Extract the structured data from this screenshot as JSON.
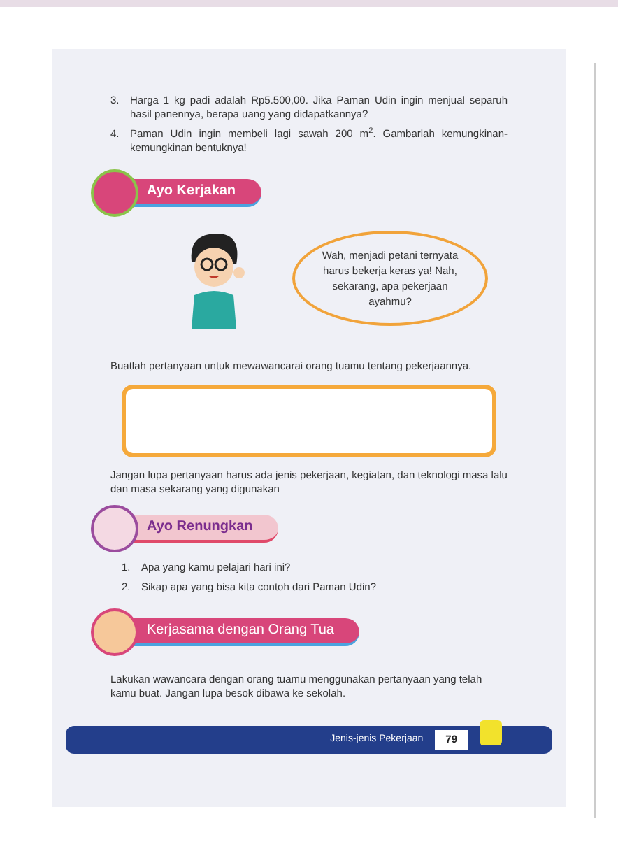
{
  "page": {
    "questions": [
      {
        "number": "3.",
        "text": "Harga 1 kg padi adalah Rp5.500,00. Jika Paman Udin ingin menjual separuh hasil panennya, berapa uang yang didapatkannya?"
      },
      {
        "number": "4.",
        "text": "Paman Udin ingin membeli lagi sawah 200 m$^{2}$. Gambarlah kemungkinan-kemungkinan bentuknya!"
      }
    ],
    "ayo_kerjakan": {
      "title": "Ayo Kerjakan",
      "speech": "Wah, menjadi petani ternyata harus bekerja keras ya! Nah, sekarang, apa pekerjaan ayahmu?",
      "instruction": "Buatlah pertanyaan untuk mewawancarai orang tuamu tentang pekerjaannya.",
      "note": "Jangan lupa pertanyaan harus ada jenis pekerjaan, kegiatan, dan teknologi  masa lalu dan masa sekarang yang digunakan"
    },
    "ayo_renungkan": {
      "title": "Ayo Renungkan",
      "items": [
        {
          "number": "1.",
          "text": "Apa yang kamu pelajari hari ini?"
        },
        {
          "number": "2.",
          "text": "Sikap apa yang bisa kita contoh dari Paman Udin?"
        }
      ]
    },
    "kerjasama": {
      "title": "Kerjasama dengan Orang Tua",
      "text": "Lakukan wawancara dengan orang tuamu menggunakan pertanyaan yang telah kamu buat. Jangan lupa besok dibawa ke sekolah."
    },
    "footer": {
      "chapter": "Jenis-jenis Pekerjaan",
      "page_number": "79"
    }
  }
}
